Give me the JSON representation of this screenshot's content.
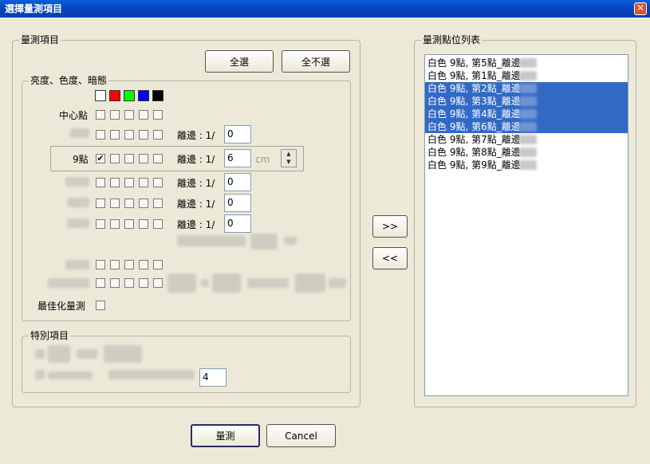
{
  "window": {
    "title": "選擇量測項目",
    "close_glyph": "✕"
  },
  "measure_group": {
    "title": "量測項目",
    "select_all": "全選",
    "select_none": "全不選",
    "sub_title": "亮度、色度、暗態",
    "swatch_colors": [
      "#ffffff",
      "#ff0000",
      "#00ff00",
      "#0000ff",
      "#000000"
    ],
    "center_label": "中心點",
    "nine_label": "9點",
    "edge_label": "離邊 : 1/",
    "row_a_edge_value": "0",
    "nine_edge_value": "6",
    "nine_unit": "cm",
    "row_c_edge_value": "0",
    "row_d_edge_value": "0",
    "row_e_edge_value": "0",
    "optimize_label": "最佳化量測",
    "check_mark": "✔"
  },
  "special_group": {
    "title": "特別項目",
    "value": "4"
  },
  "points_group": {
    "title": "量測點位列表",
    "items": [
      {
        "text": "白色  9點, 第5點_離邊:",
        "selected": false
      },
      {
        "text": "白色  9點, 第1點_離邊:",
        "selected": false
      },
      {
        "text": "白色  9點, 第2點_離邊:",
        "selected": true
      },
      {
        "text": "白色  9點, 第3點_離邊:",
        "selected": true
      },
      {
        "text": "白色  9點, 第4點_離邊:",
        "selected": true
      },
      {
        "text": "白色  9點, 第6點_離邊:",
        "selected": true
      },
      {
        "text": "白色  9點, 第7點_離邊:",
        "selected": false
      },
      {
        "text": "白色  9點, 第8點_離邊:",
        "selected": false
      },
      {
        "text": "白色  9點, 第9點_離邊:",
        "selected": false
      }
    ]
  },
  "transfer": {
    "add": ">>",
    "remove": "<<"
  },
  "footer": {
    "measure": "量測",
    "cancel": "Cancel"
  }
}
